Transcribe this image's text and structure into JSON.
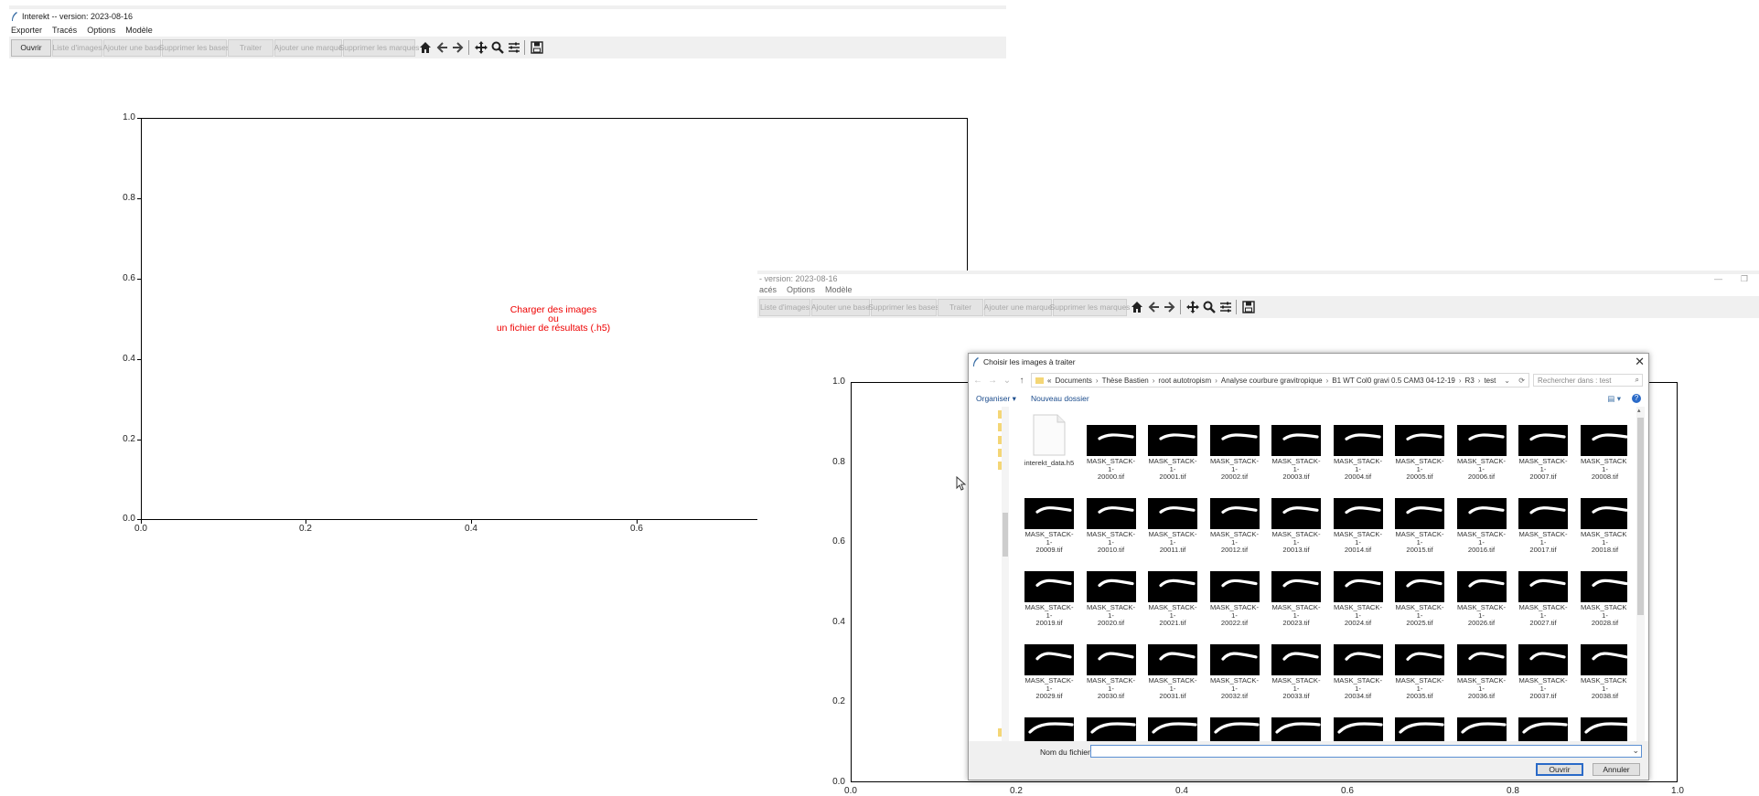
{
  "window1": {
    "title": "Interekt -- version: 2023-08-16",
    "menu": [
      "Exporter",
      "Tracés",
      "Options",
      "Modèle"
    ],
    "toolbar": {
      "buttons": [
        "Ouvrir",
        "Liste d'images",
        "Ajouter une base",
        "Supprimer les bases",
        "Traiter",
        "Ajouter une marque",
        "Supprimer les marques"
      ],
      "icons": [
        "home-icon",
        "back-arrow-icon",
        "forward-arrow-icon",
        "pan-icon",
        "zoom-icon",
        "configure-icon",
        "save-icon"
      ]
    },
    "plot": {
      "yticks": [
        "1.0",
        "0.8",
        "0.6",
        "0.4",
        "0.2",
        "0.0"
      ],
      "xticks": [
        "0.0",
        "0.2",
        "0.4",
        "0.6"
      ],
      "prompt": [
        "Charger des images",
        "ou",
        "un fichier de résultats (.h5)"
      ]
    }
  },
  "window2": {
    "title": "- version: 2023-08-16",
    "menu": [
      "acés",
      "Options",
      "Modèle"
    ],
    "toolbar": {
      "buttons": [
        "Liste d'images",
        "Ajouter une base",
        "Supprimer les bases",
        "Traiter",
        "Ajouter une marque",
        "Supprimer les marques"
      ]
    },
    "plot": {
      "yticks": [
        "1.0",
        "0.8",
        "0.6",
        "0.4",
        "0.2",
        "0.0"
      ],
      "xticks": [
        "0.0",
        "0.2",
        "0.4",
        "0.6",
        "0.8",
        "1.0"
      ]
    }
  },
  "dialog": {
    "title": "Choisir les images à traiter",
    "breadcrumb": [
      "«",
      "Documents",
      "Thèse Bastien",
      "root autotropism",
      "Analyse courbure gravitropique",
      "B1 WT Col0 gravi 0.5 CAM3 04-12-19",
      "R3",
      "test"
    ],
    "search_placeholder": "Rechercher dans : test",
    "organiser": "Organiser ▾",
    "new_folder": "Nouveau dossier",
    "filename_label": "Nom du fichier :",
    "open_button": "Ouvrir",
    "cancel_button": "Annuler",
    "h5_file": "interekt_data.h5",
    "files": [
      [
        "MASK_STACK-1-",
        "20000.tif"
      ],
      [
        "MASK_STACK-1-",
        "20001.tif"
      ],
      [
        "MASK_STACK-1-",
        "20002.tif"
      ],
      [
        "MASK_STACK-1-",
        "20003.tif"
      ],
      [
        "MASK_STACK-1-",
        "20004.tif"
      ],
      [
        "MASK_STACK-1-",
        "20005.tif"
      ],
      [
        "MASK_STACK-1-",
        "20006.tif"
      ],
      [
        "MASK_STACK-1-",
        "20007.tif"
      ],
      [
        "MASK_STACK-1-",
        "20008.tif"
      ],
      [
        "MASK_STACK-1-",
        "20009.tif"
      ],
      [
        "MASK_STACK-1-",
        "20010.tif"
      ],
      [
        "MASK_STACK-1-",
        "20011.tif"
      ],
      [
        "MASK_STACK-1-",
        "20012.tif"
      ],
      [
        "MASK_STACK-1-",
        "20013.tif"
      ],
      [
        "MASK_STACK-1-",
        "20014.tif"
      ],
      [
        "MASK_STACK-1-",
        "20015.tif"
      ],
      [
        "MASK_STACK-1-",
        "20016.tif"
      ],
      [
        "MASK_STACK-1-",
        "20017.tif"
      ],
      [
        "MASK_STACK-1-",
        "20018.tif"
      ],
      [
        "MASK_STACK-1-",
        "20019.tif"
      ],
      [
        "MASK_STACK-1-",
        "20020.tif"
      ],
      [
        "MASK_STACK-1-",
        "20021.tif"
      ],
      [
        "MASK_STACK-1-",
        "20022.tif"
      ],
      [
        "MASK_STACK-1-",
        "20023.tif"
      ],
      [
        "MASK_STACK-1-",
        "20024.tif"
      ],
      [
        "MASK_STACK-1-",
        "20025.tif"
      ],
      [
        "MASK_STACK-1-",
        "20026.tif"
      ],
      [
        "MASK_STACK-1-",
        "20027.tif"
      ],
      [
        "MASK_STACK-1-",
        "20028.tif"
      ],
      [
        "MASK_STACK-1-",
        "20029.tif"
      ],
      [
        "MASK_STACK-1-",
        "20030.tif"
      ],
      [
        "MASK_STACK-1-",
        "20031.tif"
      ],
      [
        "MASK_STACK-1-",
        "20032.tif"
      ],
      [
        "MASK_STACK-1-",
        "20033.tif"
      ],
      [
        "MASK_STACK-1-",
        "20034.tif"
      ],
      [
        "MASK_STACK-1-",
        "20035.tif"
      ],
      [
        "MASK_STACK-1-",
        "20036.tif"
      ],
      [
        "MASK_STACK-1-",
        "20037.tif"
      ],
      [
        "MASK_STACK-1-",
        "20038.tif"
      ]
    ]
  },
  "colors": {
    "prompt": "#e00000",
    "accent": "#2a6ac8",
    "folder": "#f4d676"
  }
}
